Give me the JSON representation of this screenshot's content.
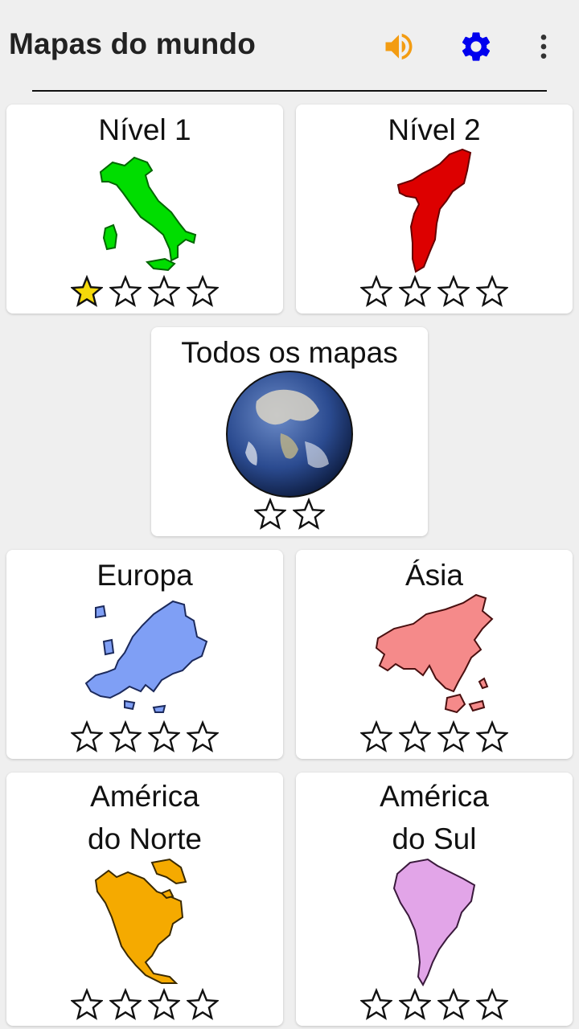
{
  "header": {
    "title": "Mapas do mundo",
    "sound_icon": "volume-icon",
    "settings_icon": "gear-icon",
    "menu_icon": "more-vert-icon"
  },
  "colors": {
    "sound": "#f39c12",
    "settings": "#0000ee",
    "star_filled": "#f5d90a",
    "level1_map": "#00dd00",
    "level2_map": "#dd0000",
    "europe": "#7f9ff5",
    "asia": "#f58a8a",
    "north_america": "#f5aa00",
    "south_america": "#e2a5e8"
  },
  "cards": [
    {
      "line1": "Nível 1",
      "line2": "",
      "stars_earned": 1,
      "stars_total": 4,
      "icon": "italy-map-icon"
    },
    {
      "line1": "Nível 2",
      "line2": "",
      "stars_earned": 0,
      "stars_total": 4,
      "icon": "mozambique-map-icon"
    },
    {
      "line1": "Todos os mapas",
      "line2": "",
      "stars_earned": 0,
      "stars_total": 2,
      "icon": "globe-icon"
    },
    {
      "line1": "Europa",
      "line2": "",
      "stars_earned": 0,
      "stars_total": 4,
      "icon": "europe-map-icon"
    },
    {
      "line1": "Ásia",
      "line2": "",
      "stars_earned": 0,
      "stars_total": 4,
      "icon": "asia-map-icon"
    },
    {
      "line1": "América",
      "line2": "do Norte",
      "stars_earned": 0,
      "stars_total": 4,
      "icon": "north-america-map-icon"
    },
    {
      "line1": "América",
      "line2": "do Sul",
      "stars_earned": 0,
      "stars_total": 4,
      "icon": "south-america-map-icon"
    }
  ]
}
